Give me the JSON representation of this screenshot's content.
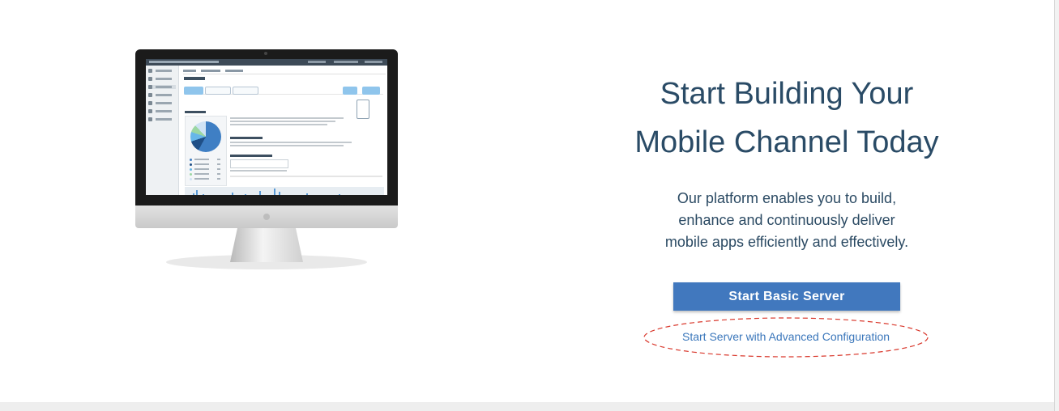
{
  "hero": {
    "headline_line1": "Start Building Your",
    "headline_line2": "Mobile Channel Today",
    "description_line1": "Our platform enables you to build,",
    "description_line2": "enhance and continuously deliver",
    "description_line3": "mobile apps efficiently and effectively."
  },
  "actions": {
    "primary_label": "Start Basic Server",
    "primary_color": "#4178be",
    "secondary_label": "Start Server with Advanced Configuration",
    "secondary_color": "#3b77bb",
    "highlight_color": "#d9382c"
  },
  "illustration": {
    "device": "desktop-monitor",
    "screen_content": "dashboard-preview"
  }
}
